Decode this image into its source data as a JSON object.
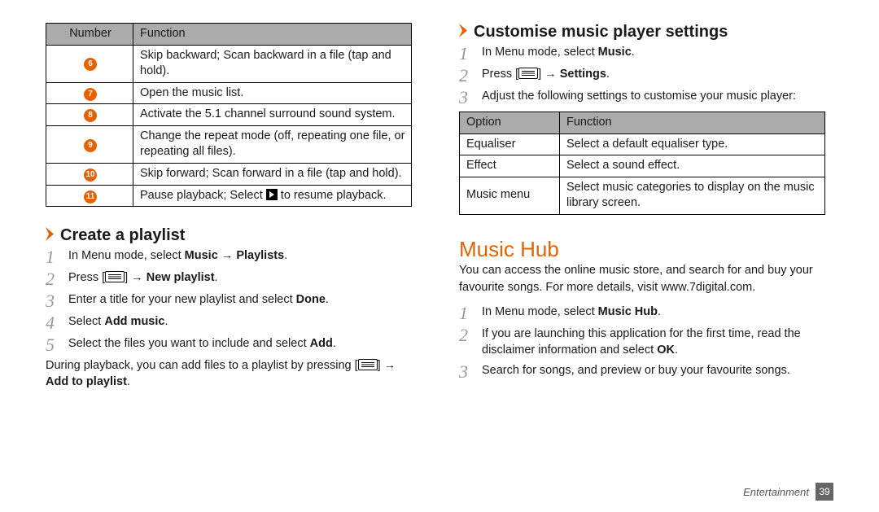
{
  "left": {
    "table_head": {
      "number": "Number",
      "function": "Function"
    },
    "rows": [
      {
        "num": "6",
        "text": "Skip backward; Scan backward in a file (tap and hold)."
      },
      {
        "num": "7",
        "text": "Open the music list."
      },
      {
        "num": "8",
        "text": "Activate the 5.1 channel surround sound system."
      },
      {
        "num": "9",
        "text": "Change the repeat mode (off, repeating one file, or repeating all files)."
      },
      {
        "num": "10",
        "text": "Skip forward; Scan forward in a file (tap and hold)."
      },
      {
        "num": "11",
        "pre": "Pause playback; Select ",
        "post": " to resume playback."
      }
    ],
    "sub_heading": "Create a playlist",
    "steps": [
      {
        "n": "1",
        "parts": [
          "In Menu mode, select ",
          "Music",
          " → ",
          "Playlists",
          "."
        ]
      },
      {
        "n": "2",
        "parts": [
          "Press [",
          "MENU_KEY",
          "] → ",
          "New playlist",
          "."
        ]
      },
      {
        "n": "3",
        "parts": [
          "Enter a title for your new playlist and select ",
          "Done",
          "."
        ]
      },
      {
        "n": "4",
        "parts": [
          "Select ",
          "Add music",
          "."
        ]
      },
      {
        "n": "5",
        "parts": [
          "Select the files you want to include and select ",
          "Add",
          "."
        ]
      }
    ],
    "after_steps": {
      "pre": "During playback, you can add files to a playlist by pressing [",
      "post": "] → ",
      "bold": "Add to playlist",
      "end": "."
    }
  },
  "right": {
    "sub_heading": "Customise music player settings",
    "steps1": [
      {
        "n": "1",
        "parts": [
          "In Menu mode, select ",
          "Music",
          "."
        ]
      },
      {
        "n": "2",
        "parts": [
          "Press [",
          "MENU_KEY",
          "] → ",
          "Settings",
          "."
        ]
      },
      {
        "n": "3",
        "parts": [
          "Adjust the following settings to customise your music player:"
        ]
      }
    ],
    "table_head": {
      "option": "Option",
      "function": "Function"
    },
    "rows": [
      {
        "opt": "Equaliser",
        "text": "Select a default equaliser type."
      },
      {
        "opt": "Effect",
        "text": "Select a sound effect."
      },
      {
        "opt": "Music menu",
        "text": "Select music categories to display on the music library screen."
      }
    ],
    "main_heading": "Music Hub",
    "paragraph": "You can access the online music store, and search for and buy your favourite songs. For more details, visit www.7digital.com.",
    "steps2": [
      {
        "n": "1",
        "parts": [
          "In Menu mode, select ",
          "Music Hub",
          "."
        ]
      },
      {
        "n": "2",
        "parts": [
          "If you are launching this application for the first time, read the disclaimer information and select ",
          "OK",
          "."
        ]
      },
      {
        "n": "3",
        "parts": [
          "Search for songs, and preview or buy your favourite songs."
        ]
      }
    ]
  },
  "footer": {
    "section": "Entertainment",
    "page": "39"
  }
}
